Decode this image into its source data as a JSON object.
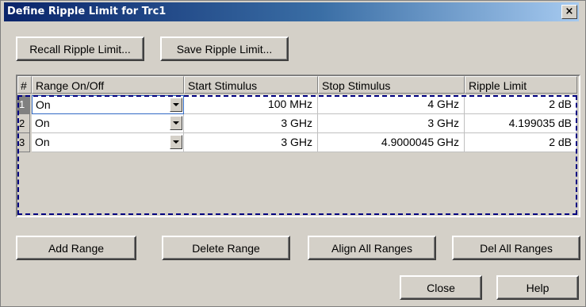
{
  "window": {
    "title": "Define Ripple Limit for Trc1",
    "close_glyph": "×"
  },
  "toolbar": {
    "recall_label": "Recall Ripple Limit...",
    "save_label": "Save Ripple Limit..."
  },
  "table": {
    "headers": [
      "#",
      "Range On/Off",
      "Start Stimulus",
      "Stop Stimulus",
      "Ripple Limit"
    ],
    "rows": [
      {
        "index": "1",
        "range": "On",
        "start": "100 MHz",
        "stop": "4 GHz",
        "limit": "2 dB"
      },
      {
        "index": "2",
        "range": "On",
        "start": "3 GHz",
        "stop": "3 GHz",
        "limit": "4.199035 dB"
      },
      {
        "index": "3",
        "range": "On",
        "start": "3 GHz",
        "stop": "4.9000045 GHz",
        "limit": "2 dB"
      }
    ],
    "active_row": 1
  },
  "actions": {
    "add_label": "Add Range",
    "delete_label": "Delete Range",
    "align_label": "Align All Ranges",
    "del_all_label": "Del All Ranges"
  },
  "footer": {
    "close_label": "Close",
    "help_label": "Help"
  },
  "colors": {
    "dialog_bg": "#d4d0c8",
    "title_start": "#0a246a",
    "title_end": "#a6caf0",
    "focus_dash": "#000080"
  },
  "icons": {
    "dropdown": "chevron-down-icon",
    "close": "close-icon"
  }
}
